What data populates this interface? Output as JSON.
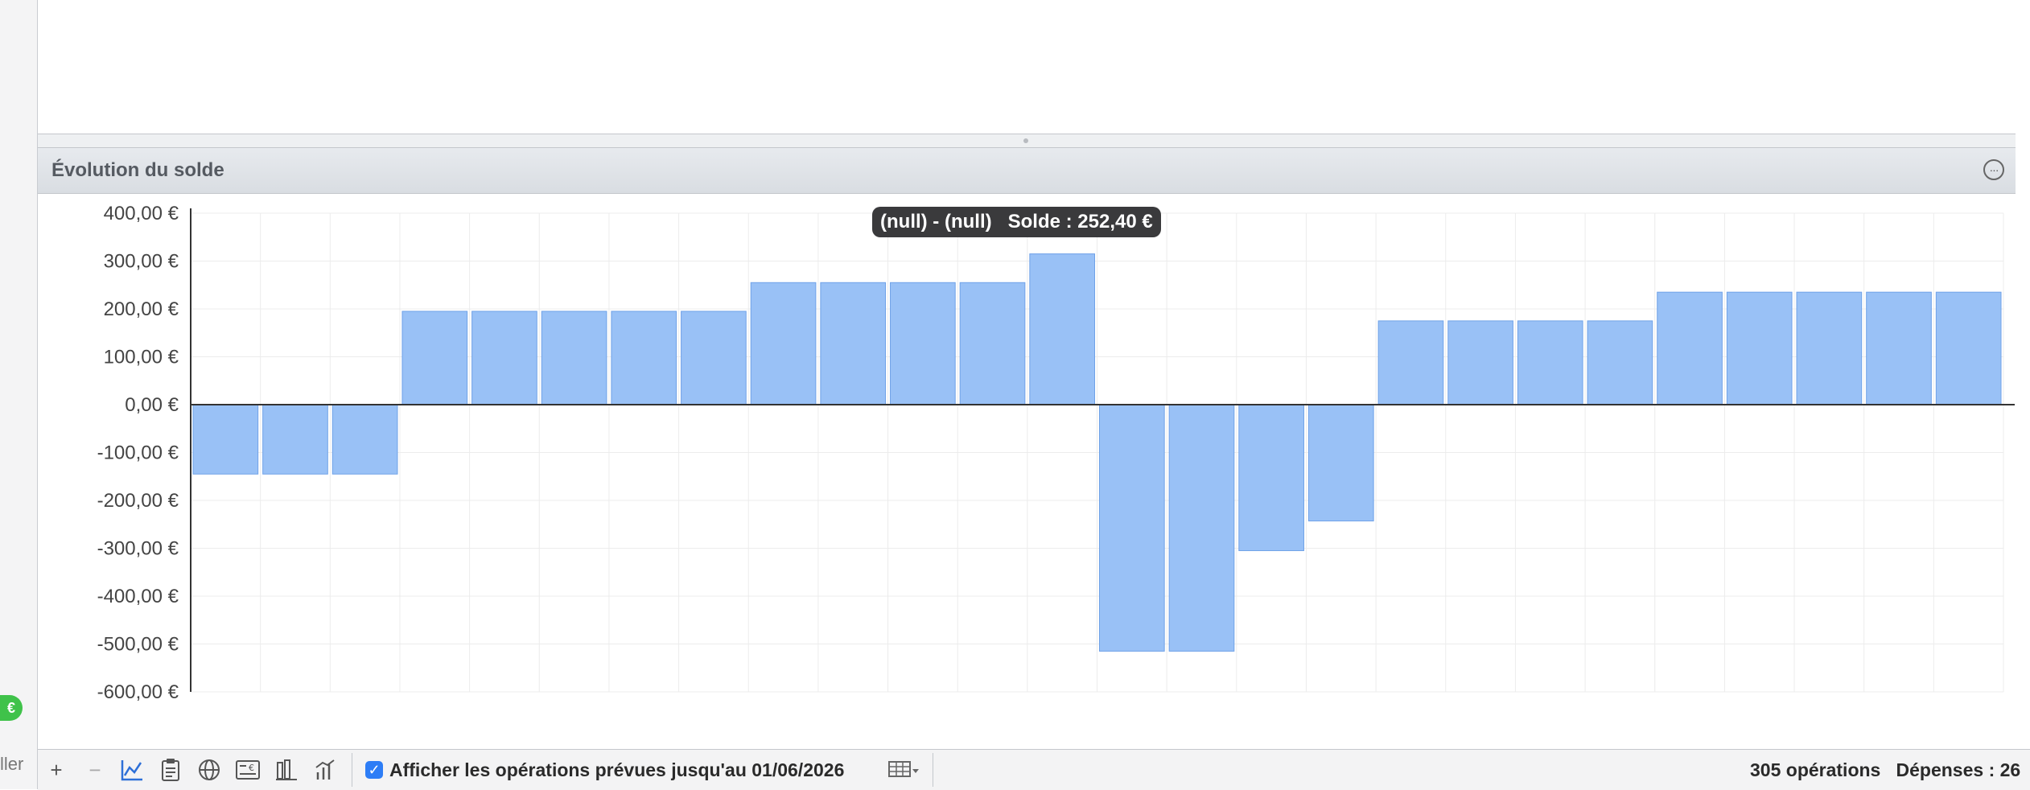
{
  "sidebar": {
    "badge_symbol": "€",
    "cut_label": "ller"
  },
  "panel": {
    "title": "Évolution du solde",
    "more_icon": "ellipsis-circle-icon"
  },
  "tooltip": {
    "text": "(null) - (null)   Solde : 252,40 €"
  },
  "chart_data": {
    "type": "bar",
    "color": "#99c1f6",
    "border_color": "#6fa2e8",
    "ylim": [
      -600,
      400
    ],
    "yticks": [
      400,
      300,
      200,
      100,
      0,
      -100,
      -200,
      -300,
      -400,
      -500,
      -600
    ],
    "ytick_labels": [
      "400,00 €",
      "300,00 €",
      "200,00 €",
      "100,00 €",
      "0,00 €",
      "-100,00 €",
      "-200,00 €",
      "-300,00 €",
      "-400,00 €",
      "-500,00 €",
      "-600,00 €"
    ],
    "values": [
      -145,
      -145,
      -145,
      195,
      195,
      195,
      195,
      195,
      255,
      255,
      255,
      255,
      315,
      -515,
      -515,
      -305,
      -243,
      175,
      175,
      175,
      175,
      235,
      235,
      235,
      235,
      235
    ],
    "grid": true
  },
  "toolbar": {
    "buttons": [
      {
        "name": "add-button",
        "icon": "plus-icon",
        "glyph": "+"
      },
      {
        "name": "remove-button",
        "icon": "minus-icon",
        "glyph": "−"
      },
      {
        "name": "chart-line-button",
        "icon": "line-chart-icon",
        "glyph": ""
      },
      {
        "name": "clipboard-button",
        "icon": "clipboard-icon",
        "glyph": ""
      },
      {
        "name": "globe-button",
        "icon": "globe-icon",
        "glyph": ""
      },
      {
        "name": "check-euro-button",
        "icon": "check-euro-icon",
        "glyph": ""
      },
      {
        "name": "bars-button",
        "icon": "bars-icon",
        "glyph": ""
      },
      {
        "name": "bar-chart-button",
        "icon": "bar-chart-icon",
        "glyph": ""
      }
    ],
    "show_planned_checked": true,
    "show_planned_label": "Afficher les opérations prévues jusqu'au 01/06/2026",
    "table_icon": "table-dropdown-icon"
  },
  "status": {
    "text": "305 opérations   Dépenses : 26"
  }
}
